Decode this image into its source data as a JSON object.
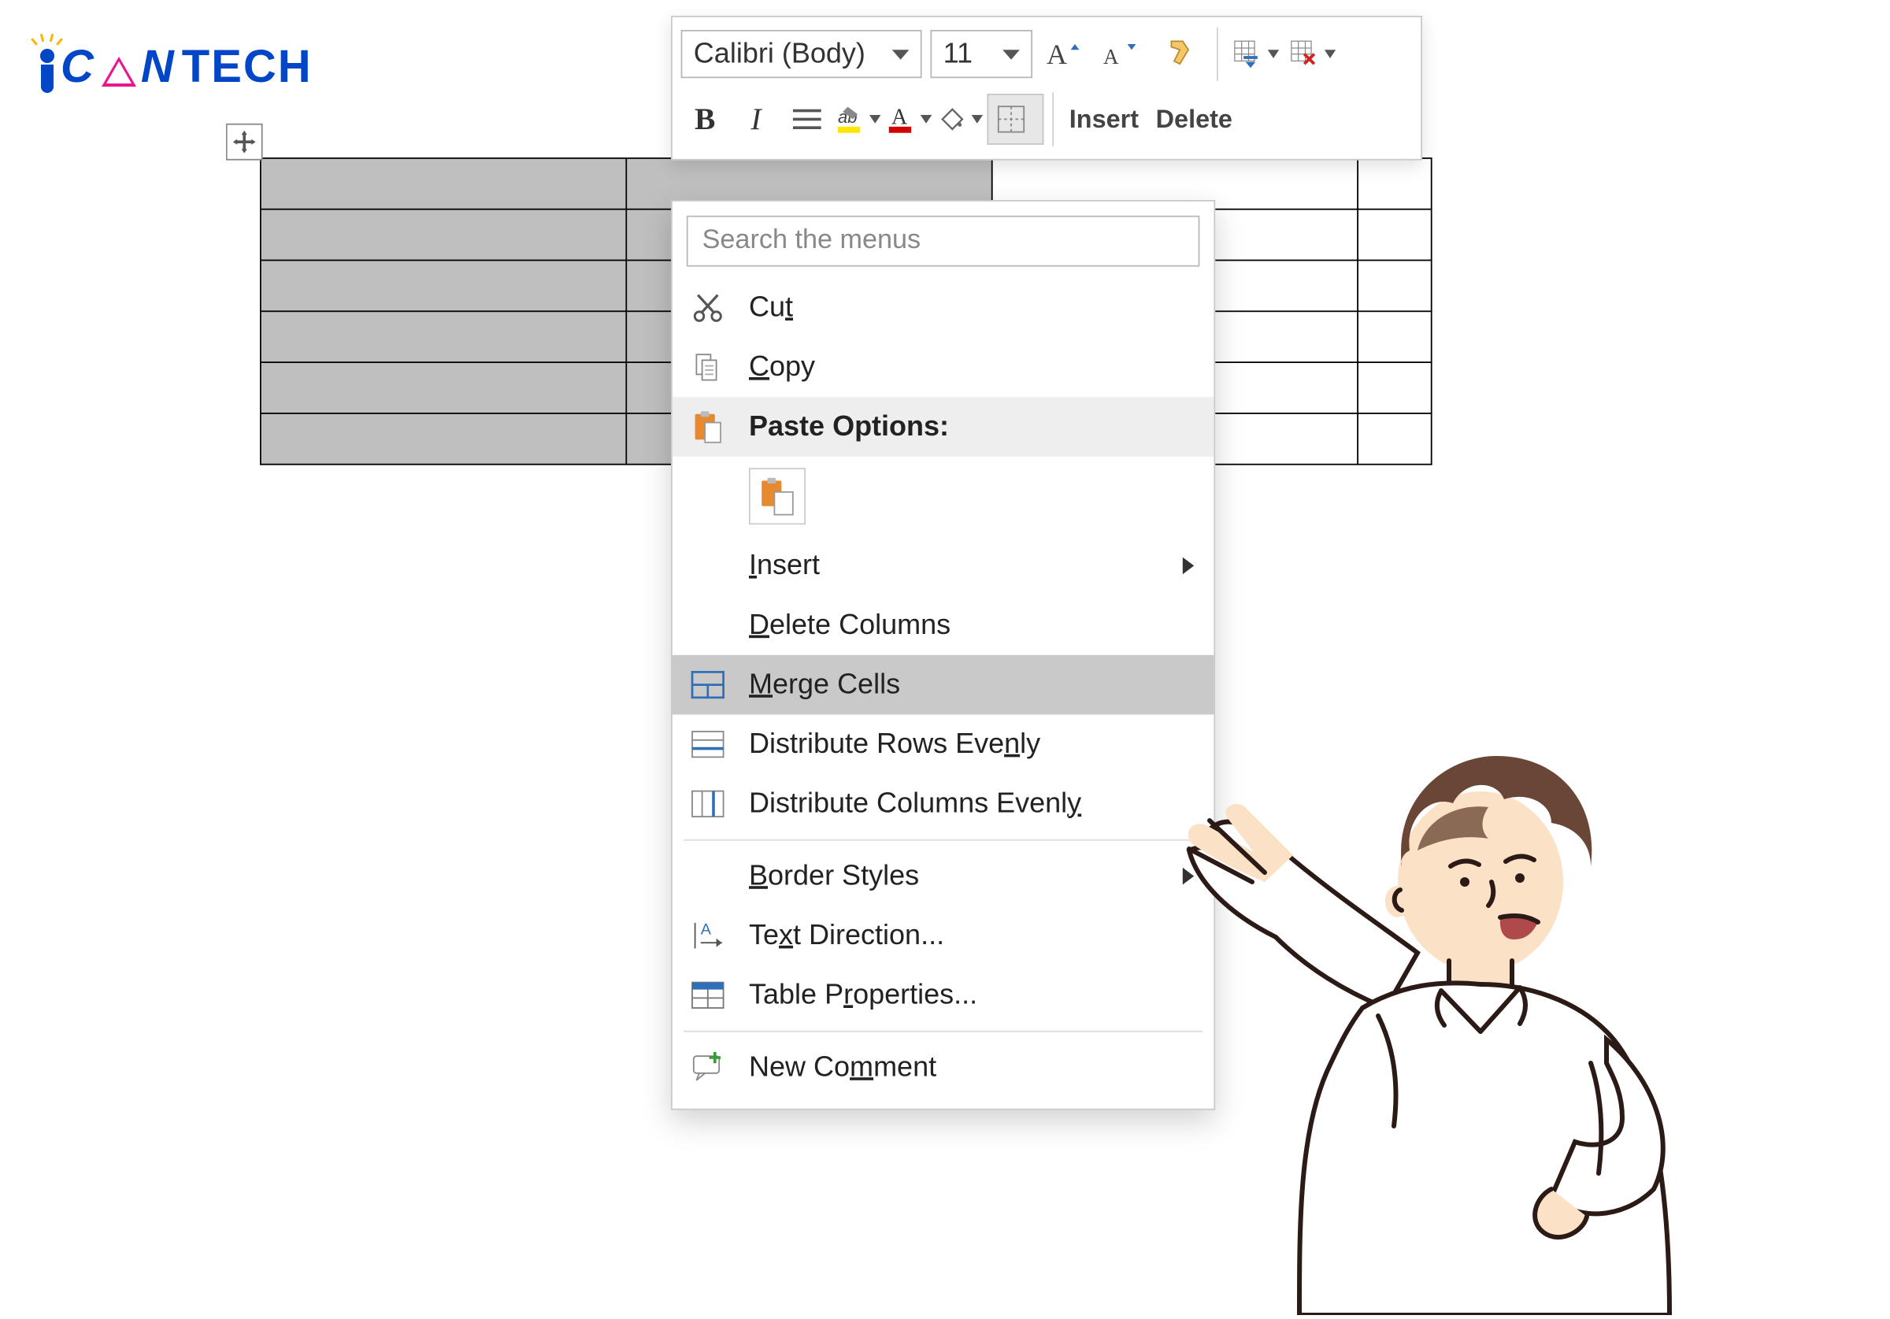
{
  "logo": {
    "can_c": "C",
    "can_n": "N",
    "tech": "TECH"
  },
  "toolbar": {
    "font_name": "Calibri (Body)",
    "font_size": "11",
    "insert_label": "Insert",
    "delete_label": "Delete"
  },
  "context_menu": {
    "search_placeholder": "Search the menus",
    "cut": {
      "pre": "Cu",
      "u": "t",
      "post": ""
    },
    "copy": {
      "pre": "",
      "u": "C",
      "post": "opy"
    },
    "paste_header": "Paste Options:",
    "insert": {
      "pre": "",
      "u": "I",
      "post": "nsert"
    },
    "delete_cols": {
      "pre": "",
      "u": "D",
      "post": "elete Columns"
    },
    "merge": {
      "pre": "",
      "u": "M",
      "post": "erge Cells"
    },
    "dist_rows": {
      "pre": "Distribute Rows Eve",
      "u": "n",
      "post": "ly"
    },
    "dist_cols": {
      "pre": "Distribute Columns Evenl",
      "u": "y",
      "post": ""
    },
    "border_styles": {
      "pre": "",
      "u": "B",
      "post": "order Styles"
    },
    "text_dir": {
      "pre": "Te",
      "u": "x",
      "post": "t Direction..."
    },
    "table_props": {
      "pre": "Table P",
      "u": "r",
      "post": "operties..."
    },
    "new_comment": {
      "pre": "New Co",
      "u": "m",
      "post": "ment"
    }
  },
  "table": {
    "rows": 6,
    "cols": 4,
    "selected_cols": 2
  },
  "colors": {
    "highlight": "#ffe600",
    "fontcolor": "#d40000",
    "accent_blue": "#2f6fb9",
    "accent_orange": "#e9892f"
  }
}
